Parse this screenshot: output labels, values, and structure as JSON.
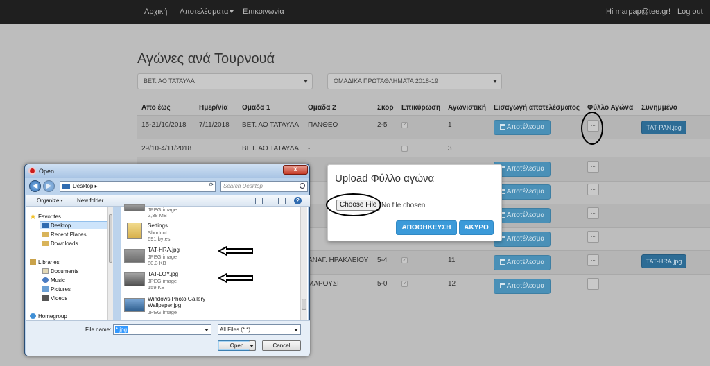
{
  "navbar": {
    "links": [
      "Αρχική",
      "Αποτελέσματα",
      "Επικοινωνία"
    ],
    "user_greeting": "Hi marpap@tee.gr!",
    "logout": "Log out"
  },
  "page": {
    "title": "Αγώνες ανά Τουρνουά",
    "team_select": "ΒΕΤ. ΑΟ ΤΑΤΑΥΛΑ",
    "tournament_select": "ΟΜΑΔΙΚΑ ΠΡΩΤΑΘΛΗΜΑΤΑ 2018-19"
  },
  "table": {
    "headers": [
      "Απο έως",
      "Ημερ/νία",
      "Ομαδα 1",
      "Ομαδα 2",
      "Σκορ",
      "Επικύρωση",
      "Αγωνιστική",
      "Εισαγωγή αποτελέσματος",
      "Φύλλο Αγώνα",
      "Συνημμένο"
    ],
    "rows": [
      {
        "range": "15-21/10/2018",
        "date": "7/11/2018",
        "team1": "ΒΕΤ. ΑΟ ΤΑΤΑΥΛΑ",
        "team2": "ΠΑΝΘΕΟ",
        "score": "2-5",
        "round": "1",
        "attachment": "TAT-PAN.jpg"
      },
      {
        "range": "29/10-4/11/2018",
        "date": "",
        "team1": "ΒΕΤ. ΑΟ ΤΑΤΑΥΛΑ",
        "team2": "-",
        "score": "",
        "round": "3",
        "attachment": ""
      },
      {
        "range": "",
        "date": "",
        "team1": "",
        "team2": "ΑΝΑΓ. ΗΡΑΚΛΕΙΟΥ",
        "score": "5-4",
        "round": "11",
        "attachment": "TAT-HRA.jpg"
      },
      {
        "range": "",
        "date": "",
        "team1": "",
        "team2": "ΜΑΡΟΥΣΙ",
        "score": "5-0",
        "round": "12",
        "attachment": ""
      }
    ],
    "result_button": "Αποτέλεσμα",
    "sheet_button": "..."
  },
  "modal": {
    "title": "Upload Φύλλο αγώνα",
    "choose_file": "Choose File",
    "no_file": "No file chosen",
    "save": "ΑΠΟΘΗΚΕΥΣΗ",
    "cancel": "ΑΚΥΡΟ"
  },
  "dialog": {
    "title": "Open",
    "close": "x",
    "location": "Desktop",
    "search_placeholder": "Search Desktop",
    "organize": "Organize",
    "new_folder": "New folder",
    "nav": {
      "favorites": "Favorites",
      "desktop": "Desktop",
      "recent_places": "Recent Places",
      "downloads": "Downloads",
      "libraries": "Libraries",
      "documents": "Documents",
      "music": "Music",
      "pictures": "Pictures",
      "videos": "Videos",
      "homegroup": "Homegroup"
    },
    "files": [
      {
        "name": "",
        "type": "JPEG image",
        "size": "2,38 MB"
      },
      {
        "name": "Settings",
        "type": "Shortcut",
        "size": "691 bytes"
      },
      {
        "name": "TAT-HRA.jpg",
        "type": "JPEG image",
        "size": "80,3 KB"
      },
      {
        "name": "TAT-LOY.jpg",
        "type": "JPEG image",
        "size": "159 KB"
      },
      {
        "name": "Windows Photo Gallery",
        "name2": "Wallpaper.jpg",
        "type": "JPEG image"
      }
    ],
    "file_name_label": "File name:",
    "file_name_value": "*.jpg",
    "file_type": "All Files (*.*)",
    "open": "Open",
    "cancel": "Cancel"
  }
}
